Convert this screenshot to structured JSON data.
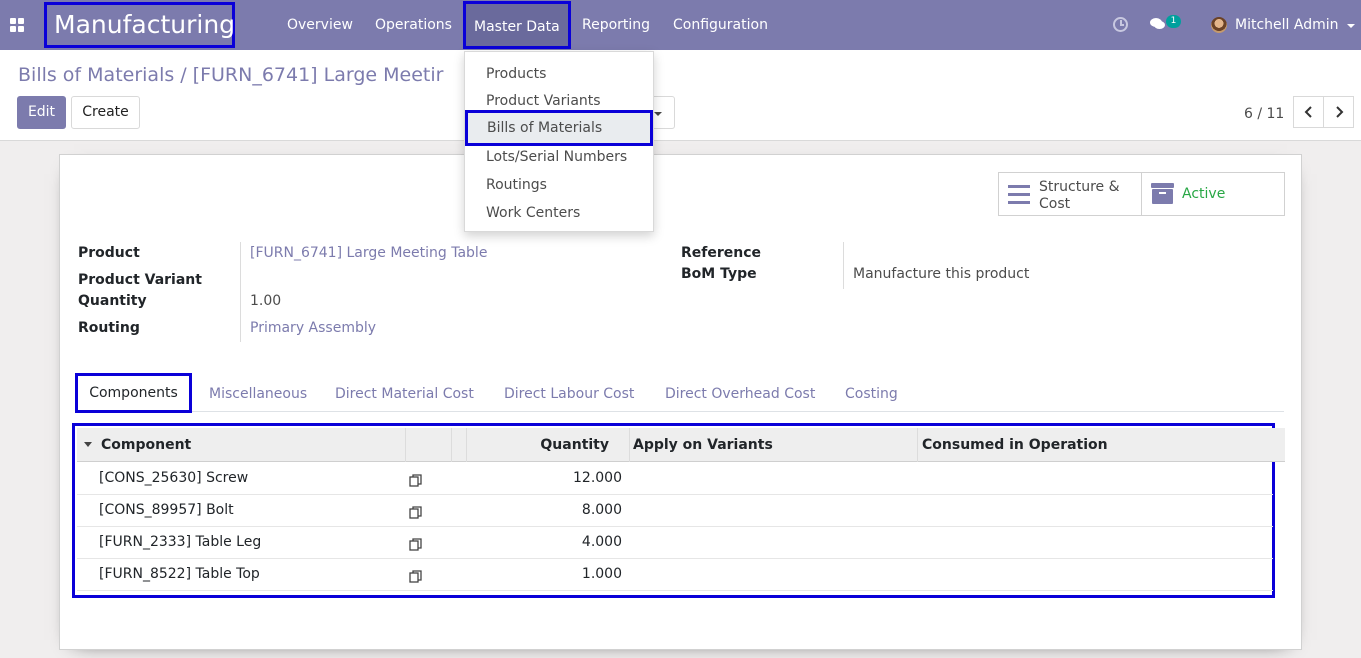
{
  "app": {
    "name": "Manufacturing",
    "colors": {
      "primary": "#7c7bad",
      "highlight_box": "#0a00d8",
      "active_status": "#28a745"
    }
  },
  "navbar": {
    "menus": [
      "Overview",
      "Operations",
      "Master Data",
      "Reporting",
      "Configuration"
    ],
    "chat_badge": "1",
    "user": "Mitchell Admin",
    "icons": [
      "apps-icon",
      "clock-icon",
      "chat-icon",
      "avatar"
    ]
  },
  "master_data_menu": {
    "items": [
      "Products",
      "Product Variants",
      "Bills of Materials",
      "Lots/Serial Numbers",
      "Routings",
      "Work Centers"
    ],
    "selected": "Bills of Materials"
  },
  "breadcrumb": {
    "parent": "Bills of Materials",
    "separator": "/",
    "current": "[FURN_6741] Large Meetir"
  },
  "actions": {
    "edit": "Edit",
    "create": "Create"
  },
  "pager": {
    "value": "6 / 11"
  },
  "smart_buttons": {
    "structure": "Structure & Cost",
    "active": "Active"
  },
  "form": {
    "product_label": "Product",
    "product_value": "[FURN_6741] Large Meeting Table",
    "variant_label": "Product Variant",
    "quantity_label": "Quantity",
    "quantity_value": "1.00",
    "routing_label": "Routing",
    "routing_value": "Primary Assembly",
    "reference_label": "Reference",
    "bom_type_label": "BoM Type",
    "bom_type_value": "Manufacture this product"
  },
  "tabs": [
    "Components",
    "Miscellaneous",
    "Direct Material Cost",
    "Direct Labour Cost",
    "Direct Overhead Cost",
    "Costing"
  ],
  "components_table": {
    "headers": [
      "Component",
      "Quantity",
      "Apply on Variants",
      "Consumed in Operation"
    ],
    "rows": [
      {
        "component": "[CONS_25630] Screw",
        "quantity": "12.000"
      },
      {
        "component": "[CONS_89957] Bolt",
        "quantity": "8.000"
      },
      {
        "component": "[FURN_2333] Table Leg",
        "quantity": "4.000"
      },
      {
        "component": "[FURN_8522] Table Top",
        "quantity": "1.000"
      }
    ]
  }
}
